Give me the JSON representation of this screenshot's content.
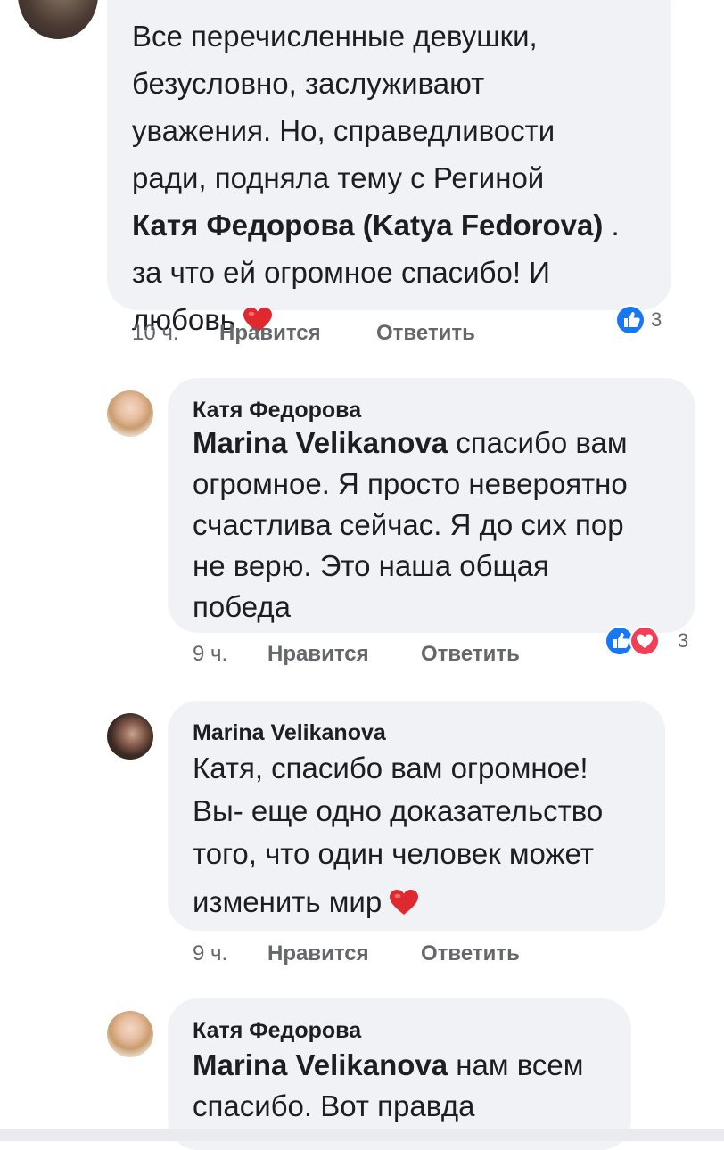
{
  "comments": [
    {
      "text_lines": [
        "Все перечисленные девушки,",
        "безусловно, заслуживают",
        "уважения. Но, справедливости",
        "ради, подняла тему с Региной"
      ],
      "mention": "Катя Федорова (Katya Fedorova)",
      "mention_suffix": " .",
      "line6": "за что ей огромное спасибо! И",
      "line7": "любовь",
      "time": "10 ч.",
      "like": "Нравится",
      "reply": "Ответить",
      "reaction_count": "3"
    },
    {
      "author": "Катя Федорова",
      "mention": "Marina Velikanova",
      "line1_rest": " спасибо вам",
      "lines": [
        "огромное. Я просто невероятно",
        "счастлива сейчас. Я до сих пор",
        "не верю. Это наша общая",
        "победа"
      ],
      "time": "9 ч.",
      "like": "Нравится",
      "reply": "Ответить",
      "reaction_count": "3"
    },
    {
      "author": "Marina Velikanova",
      "lines": [
        "Катя, спасибо вам огромное!",
        "Вы- еще одно доказательство",
        "того, что один человек может"
      ],
      "last_line": "изменить мир",
      "time": "9 ч.",
      "like": "Нравится",
      "reply": "Ответить"
    },
    {
      "author": "Катя Федорова",
      "mention": "Marina Velikanova",
      "line1_rest": " нам всем",
      "line2": "спасибо. Вот правда"
    }
  ],
  "icons": {
    "like": "like-icon",
    "love": "heart-icon"
  },
  "colors": {
    "bubble": "#f0f2f5",
    "like_blue": "#1877f2",
    "love_red": "#f33e58",
    "meta_gray": "#65676b"
  }
}
